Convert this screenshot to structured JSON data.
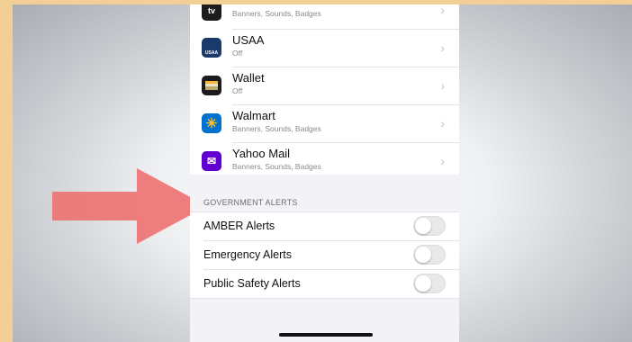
{
  "colors": {
    "border": "#f2cf94",
    "arrow": "#ee7373",
    "usaa": "#1a3a6b",
    "wallet": "#1c1c1e",
    "walmart": "#0071ce",
    "walmart_spark": "#ffc220",
    "yahoo": "#6001d2",
    "appletv": "#1c1c1e"
  },
  "apps": [
    {
      "name": "",
      "icon": "appletv-icon",
      "glyph": "tv",
      "subtitle": "Banners, Sounds, Badges"
    },
    {
      "name": "USAA",
      "icon": "usaa-icon",
      "glyph": "USAA",
      "subtitle": "Off"
    },
    {
      "name": "Wallet",
      "icon": "wallet-icon",
      "glyph": "",
      "subtitle": "Off"
    },
    {
      "name": "Walmart",
      "icon": "walmart-icon",
      "glyph": "✳",
      "subtitle": "Banners, Sounds, Badges"
    },
    {
      "name": "Yahoo Mail",
      "icon": "yahoo-mail-icon",
      "glyph": "✉",
      "subtitle": "Banners, Sounds, Badges"
    }
  ],
  "chevron": "›",
  "section_header": "GOVERNMENT ALERTS",
  "alerts": [
    {
      "label": "AMBER Alerts",
      "enabled": false
    },
    {
      "label": "Emergency Alerts",
      "enabled": false
    },
    {
      "label": "Public Safety Alerts",
      "enabled": false
    }
  ]
}
